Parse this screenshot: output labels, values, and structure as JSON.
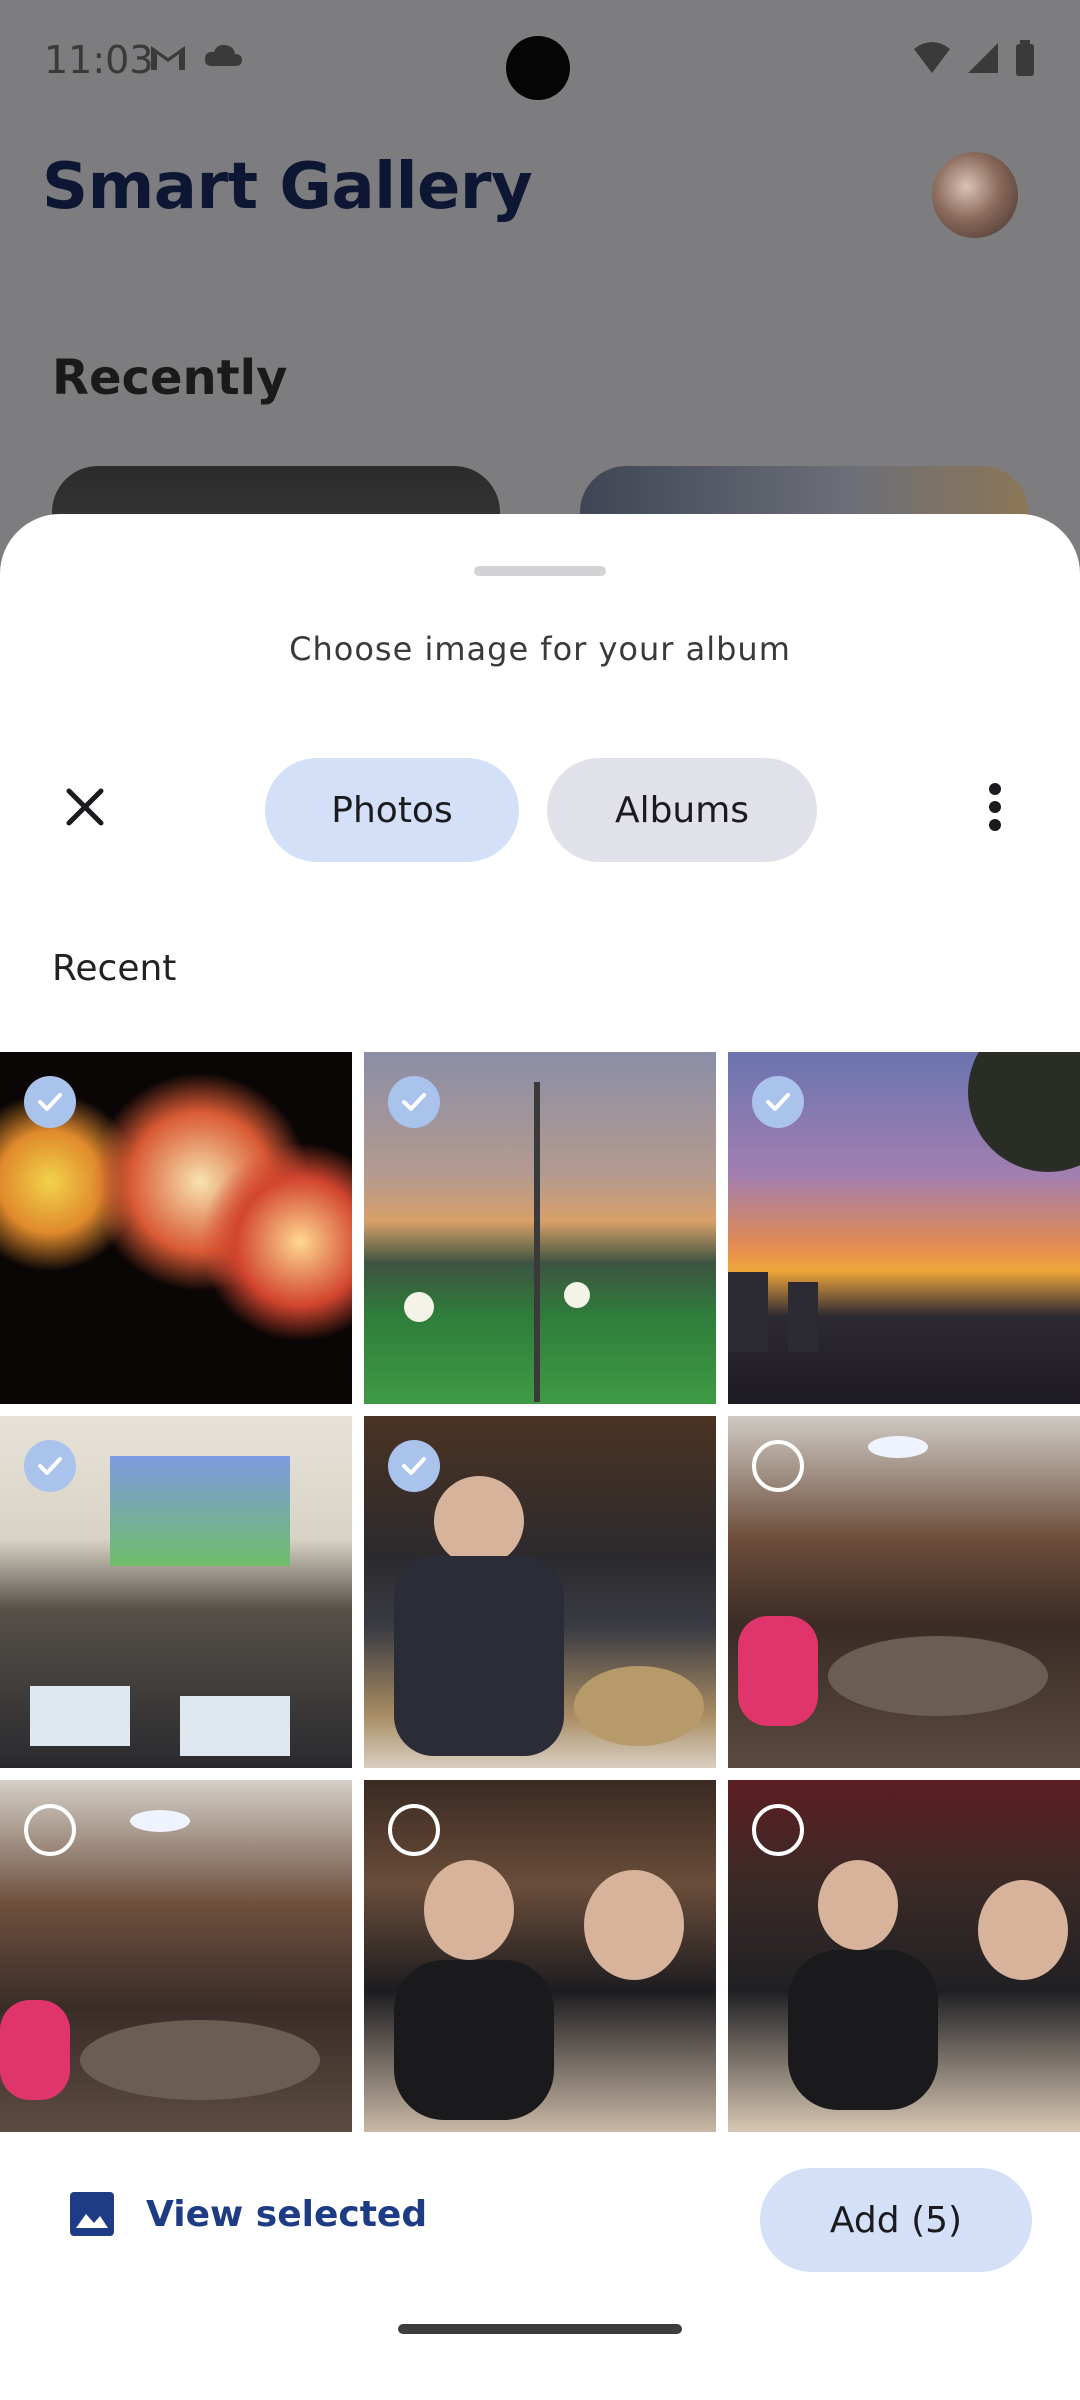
{
  "status_bar": {
    "time": "11:03"
  },
  "app": {
    "title": "Smart Gallery",
    "section_recently": "Recently"
  },
  "sheet": {
    "title": "Choose image for your album",
    "tabs": [
      {
        "label": "Photos",
        "selected": true
      },
      {
        "label": "Albums",
        "selected": false
      }
    ],
    "section_label": "Recent",
    "photos": [
      {
        "subject": "fireworks",
        "selected": true
      },
      {
        "subject": "football-field-sunset",
        "selected": true
      },
      {
        "subject": "city-sunset",
        "selected": true
      },
      {
        "subject": "group-presentation",
        "selected": true
      },
      {
        "subject": "man-pouring-drink",
        "selected": true
      },
      {
        "subject": "dinner-group",
        "selected": false
      },
      {
        "subject": "dinner-group-wide",
        "selected": false
      },
      {
        "subject": "friends-selfie",
        "selected": false
      },
      {
        "subject": "friends-selfie-2",
        "selected": false
      }
    ],
    "footer": {
      "view_selected_label": "View selected",
      "add_label": "Add (5)"
    }
  },
  "colors": {
    "accent": "#d3e0f7",
    "title": "#0d1733",
    "link": "#1e3c86",
    "check": "#a9c3ec"
  }
}
